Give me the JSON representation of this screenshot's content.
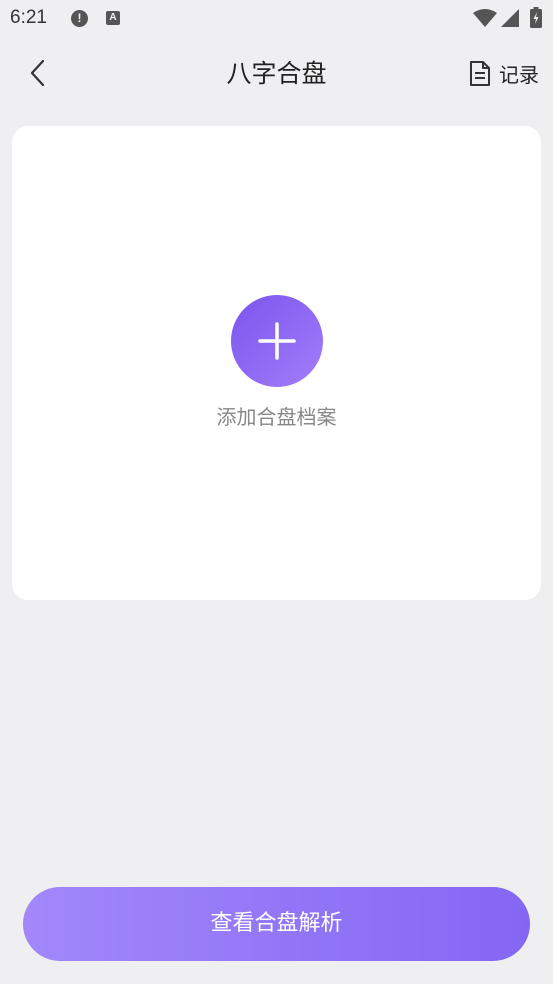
{
  "status_bar": {
    "time": "6:21",
    "alert_icon": "!",
    "a_icon": "A",
    "icons": [
      "alert-icon",
      "a-icon",
      "wifi-icon",
      "signal-icon",
      "battery-icon"
    ]
  },
  "header": {
    "title": "八字合盘",
    "back_icon": "chevron-left-icon",
    "records_label": "记录",
    "records_icon": "document-icon"
  },
  "card": {
    "add_icon": "plus-icon",
    "add_label": "添加合盘档案"
  },
  "footer": {
    "analyze_label": "查看合盘解析"
  },
  "colors": {
    "background": "#efeef0",
    "card": "#ffffff",
    "accent_start": "#7a55ee",
    "accent_end": "#a27ef9",
    "button_start": "#a288fa",
    "button_end": "#8566f4"
  }
}
